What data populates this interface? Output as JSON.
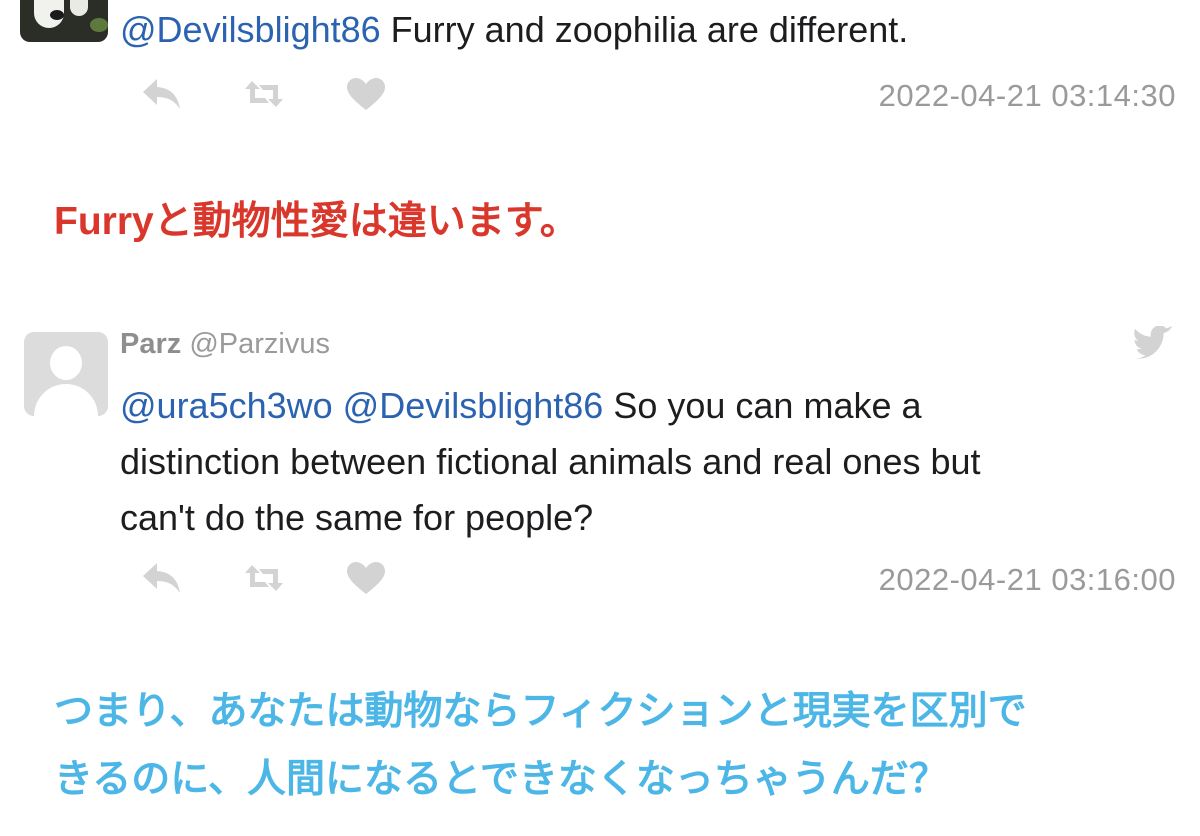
{
  "tweet1": {
    "mention": "@Devilsblight86",
    "text": " Furry and zoophilia are different.",
    "timestamp": "2022-04-21 03:14:30"
  },
  "caption1": "Furryと動物性愛は違います。",
  "tweet2": {
    "display_name": "Parz",
    "handle": "@Parzivus",
    "mentions": "@ura5ch3wo @Devilsblight86",
    "text_line1": " So you can make a",
    "text_line2": "distinction between fictional animals and real ones but",
    "text_line3": "can't do the same for people?",
    "timestamp": "2022-04-21 03:16:00"
  },
  "caption2": {
    "line1": "つまり、あなたは動物ならフィクションと現実を区別で",
    "line2": "きるのに、人間になるとできなくなっちゃうんだ？"
  },
  "icons": {
    "reply": "reply-icon",
    "retweet": "retweet-icon",
    "like": "heart-icon",
    "platform": "twitter-bird-icon"
  },
  "colors": {
    "mention": "#2c63b0",
    "caption_red": "#d9372b",
    "caption_blue": "#4cb7e6",
    "action_icon": "#d3d3d3",
    "meta_text": "#9a9a9a"
  }
}
